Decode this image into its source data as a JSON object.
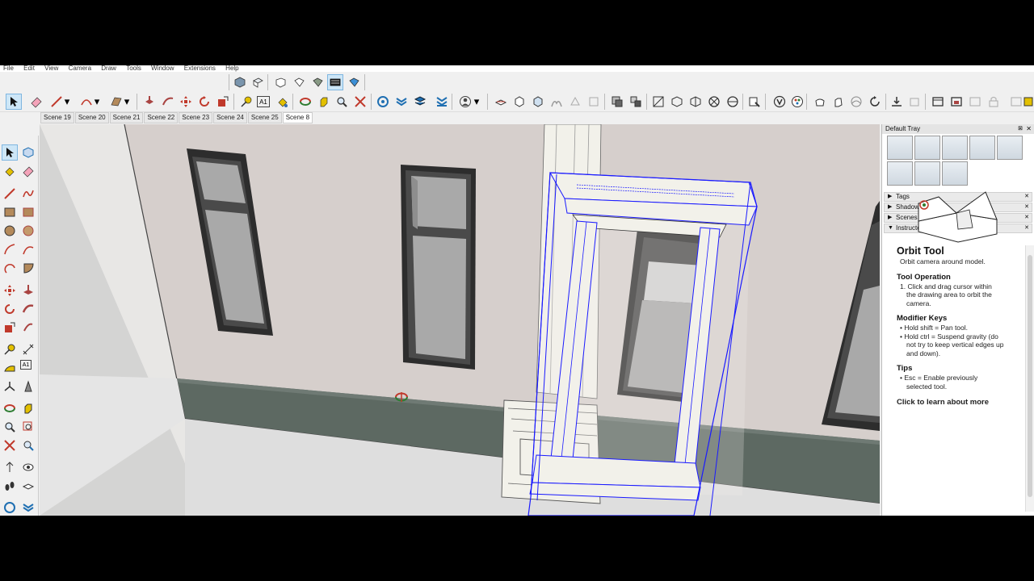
{
  "menu": [
    "File",
    "Edit",
    "View",
    "Camera",
    "Draw",
    "Tools",
    "Window",
    "Extensions",
    "Help"
  ],
  "scenes": {
    "tabs": [
      "Scene 19",
      "Scene 20",
      "Scene 21",
      "Scene 22",
      "Scene 23",
      "Scene 24",
      "Scene 25",
      "Scene 8"
    ],
    "active": "Scene 8"
  },
  "tray": {
    "title": "Default Tray",
    "close": "✕",
    "pin": "⊠",
    "panels": [
      {
        "label": "Tags",
        "expanded": false
      },
      {
        "label": "Shadows",
        "expanded": false
      },
      {
        "label": "Scenes",
        "expanded": false
      },
      {
        "label": "Instructor",
        "expanded": true
      }
    ]
  },
  "instructor": {
    "tool_name": "Orbit Tool",
    "description": "Orbit camera around model.",
    "op_heading": "Tool Operation",
    "op_1a": "1. Click and drag cursor within",
    "op_1b": "the drawing area to orbit the",
    "op_1c": "camera.",
    "mod_heading": "Modifier Keys",
    "mod_1": "• Hold shift = Pan tool.",
    "mod_2a": "• Hold ctrl = Suspend gravity (do",
    "mod_2b": "not try to keep vertical edges up",
    "mod_2c": "and down).",
    "tips_heading": "Tips",
    "tip_1a": "• Esc = Enable previously",
    "tip_1b": "selected tool.",
    "learn_more": "Click to learn about more"
  },
  "colors": {
    "wall": "#d6cfcc",
    "ground_stone": "#5d6962",
    "selection": "#1a1aff",
    "frame": "#3e3e3e",
    "glass": "#a9a9a9",
    "trim": "#f2f1ea"
  }
}
